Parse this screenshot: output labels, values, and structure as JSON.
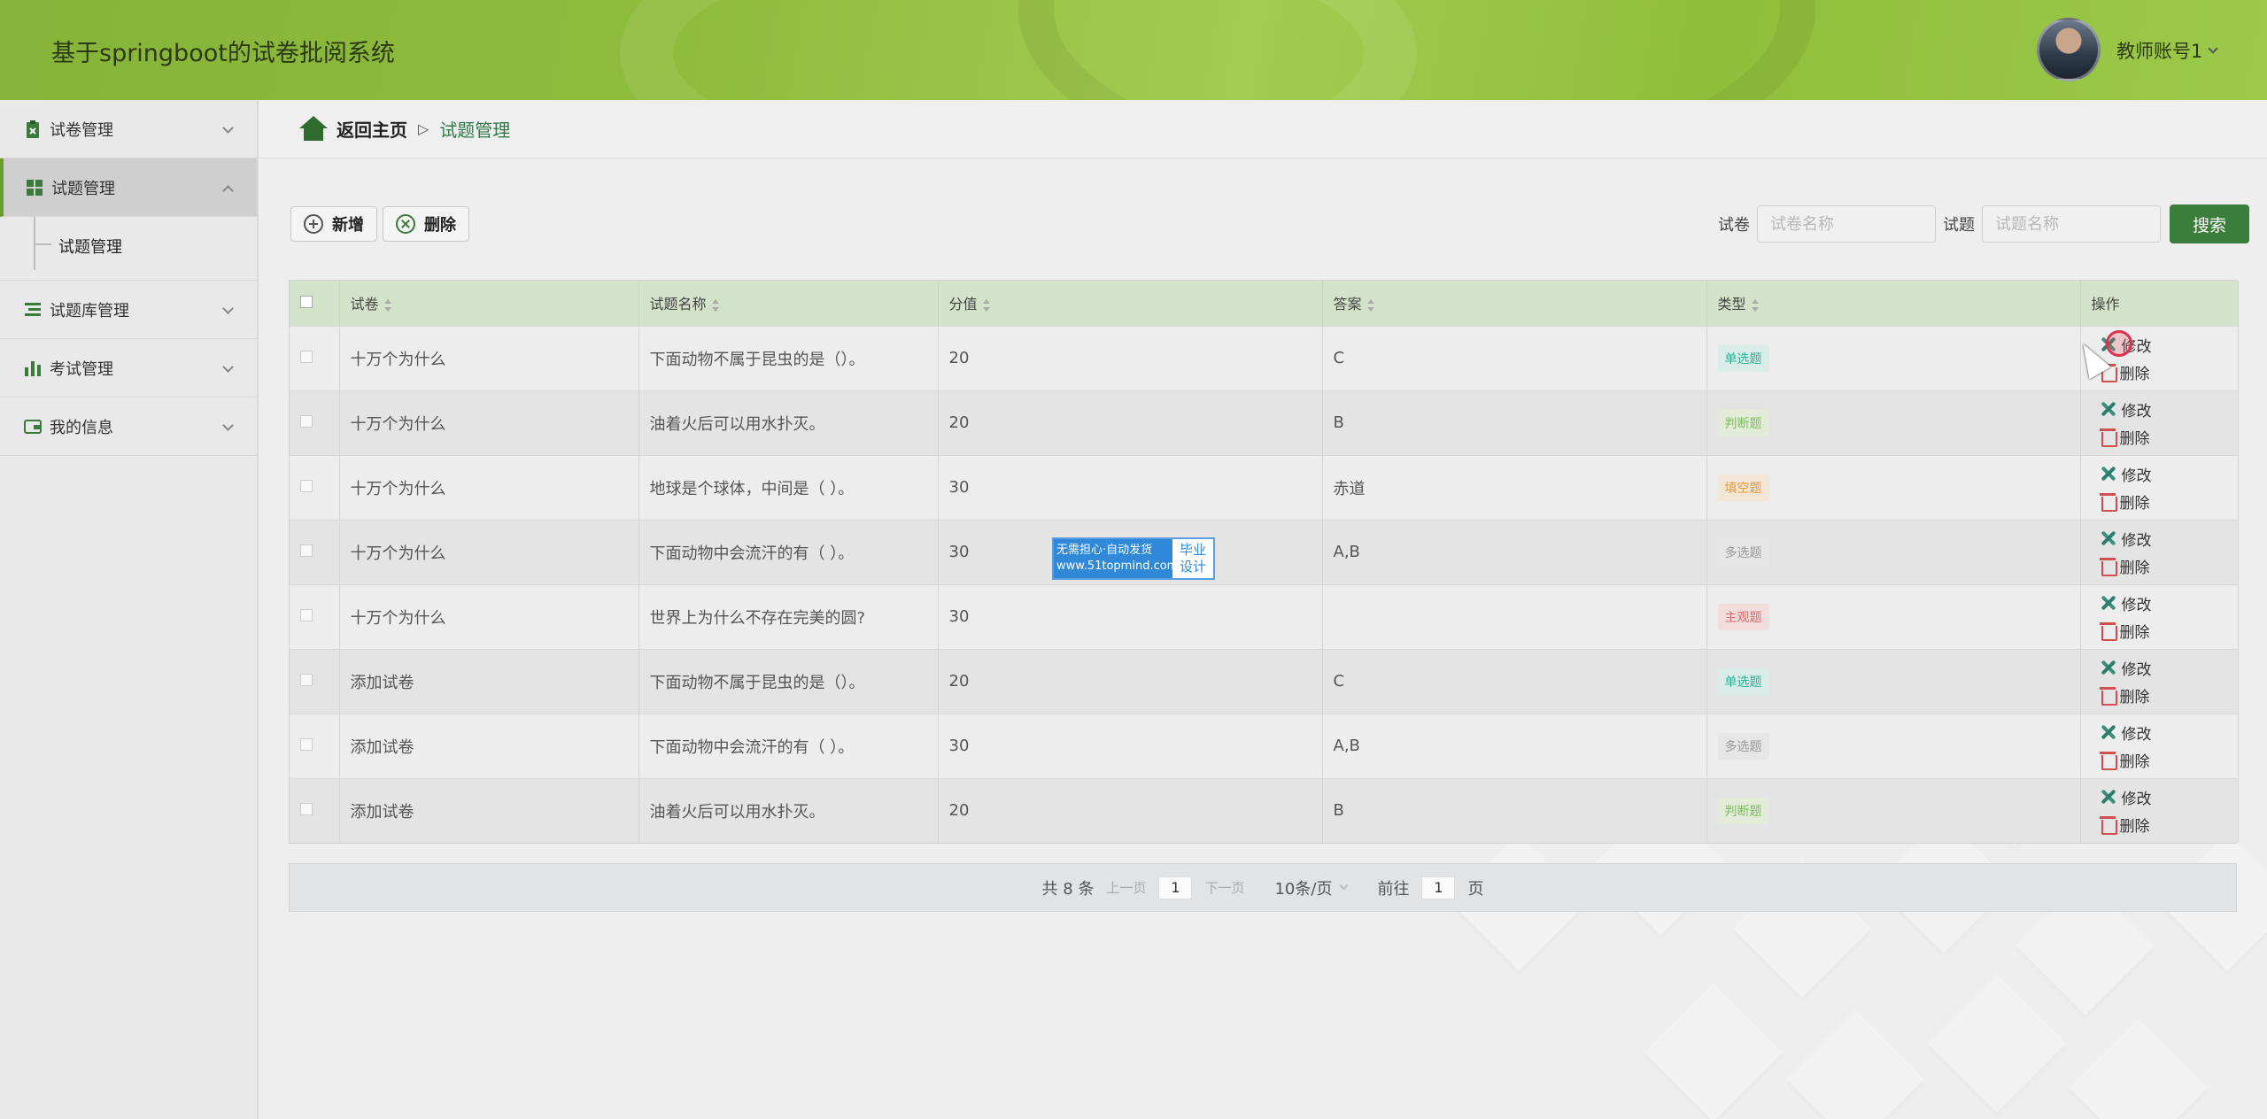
{
  "header": {
    "app_title": "基于springboot的试卷批阅系统",
    "user_label": "教师账号1"
  },
  "sidebar": {
    "items": [
      {
        "label": "试卷管理",
        "icon": "clipboard-icon",
        "expanded": false
      },
      {
        "label": "试题管理",
        "icon": "grid-icon",
        "expanded": true
      },
      {
        "label": "试题库管理",
        "icon": "list-icon",
        "expanded": false
      },
      {
        "label": "考试管理",
        "icon": "bar-chart-icon",
        "expanded": false
      },
      {
        "label": "我的信息",
        "icon": "wallet-icon",
        "expanded": false
      }
    ],
    "submenu_label": "试题管理"
  },
  "breadcrumb": {
    "home": "返回主页",
    "separator": "▷",
    "current": "试题管理"
  },
  "toolbar": {
    "add_label": "新增",
    "delete_label": "删除"
  },
  "search": {
    "paper_label": "试卷",
    "paper_placeholder": "试卷名称",
    "question_label": "试题",
    "question_placeholder": "试题名称",
    "button_label": "搜索"
  },
  "table": {
    "headers": [
      "试卷",
      "试题名称",
      "分值",
      "答案",
      "类型",
      "操作"
    ],
    "edit_label": "修改",
    "delete_label": "删除",
    "rows": [
      {
        "paper": "十万个为什么",
        "question": "下面动物不属于昆虫的是（）。",
        "score": "20",
        "answer": "C",
        "type": "单选题"
      },
      {
        "paper": "十万个为什么",
        "question": "油着火后可以用水扑灭。",
        "score": "20",
        "answer": "B",
        "type": "判断题"
      },
      {
        "paper": "十万个为什么",
        "question": "地球是个球体，中间是（ ）。",
        "score": "30",
        "answer": "赤道",
        "type": "填空题"
      },
      {
        "paper": "十万个为什么",
        "question": "下面动物中会流汗的有（ ）。",
        "score": "30",
        "answer": "A,B",
        "type": "多选题"
      },
      {
        "paper": "十万个为什么",
        "question": "世界上为什么不存在完美的圆?",
        "score": "30",
        "answer": "",
        "type": "主观题"
      },
      {
        "paper": "添加试卷",
        "question": "下面动物不属于昆虫的是（）。",
        "score": "20",
        "answer": "C",
        "type": "单选题"
      },
      {
        "paper": "添加试卷",
        "question": "下面动物中会流汗的有（ ）。",
        "score": "30",
        "answer": "A,B",
        "type": "多选题"
      },
      {
        "paper": "添加试卷",
        "question": "油着火后可以用水扑灭。",
        "score": "20",
        "answer": "B",
        "type": "判断题"
      }
    ],
    "type_colors": {
      "单选题": {
        "fg": "#2bb39a",
        "bg": "#d9ece7"
      },
      "判断题": {
        "fg": "#7cbf5a",
        "bg": "#e2ecd9"
      },
      "填空题": {
        "fg": "#e69a3a",
        "bg": "#f2e6d6"
      },
      "多选题": {
        "fg": "#999999",
        "bg": "#e6e6e6"
      },
      "主观题": {
        "fg": "#e06a6a",
        "bg": "#f2dcdc"
      }
    }
  },
  "pagination": {
    "total": "共 8 条",
    "prev": "上一页",
    "current_page": "1",
    "next": "下一页",
    "page_size": "10条/页",
    "goto_label": "前往",
    "goto_value": "1",
    "page_suffix": "页"
  },
  "watermark": {
    "line1": "无需担心·自动发货",
    "line2": "www.51topmind.com",
    "right1": "毕业",
    "right2": "设计"
  },
  "colors": {
    "header_green": "#8ebc3c",
    "accent_green": "#3b7d3b",
    "table_header": "#d3e3c9"
  }
}
